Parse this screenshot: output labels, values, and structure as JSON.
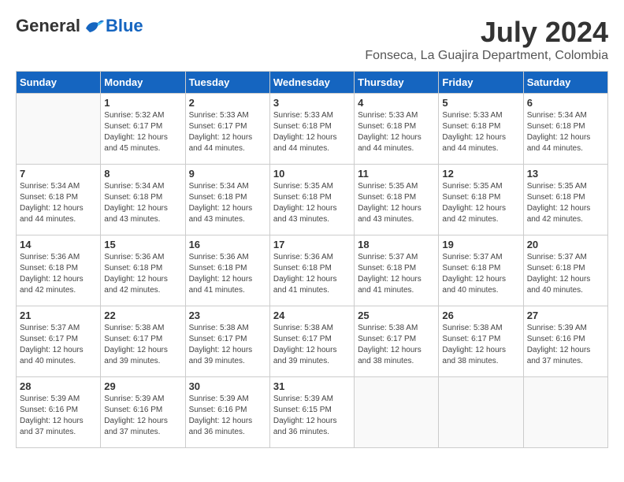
{
  "logo": {
    "general": "General",
    "blue": "Blue"
  },
  "title": {
    "month_year": "July 2024",
    "location": "Fonseca, La Guajira Department, Colombia"
  },
  "weekdays": [
    "Sunday",
    "Monday",
    "Tuesday",
    "Wednesday",
    "Thursday",
    "Friday",
    "Saturday"
  ],
  "weeks": [
    [
      {
        "day": "",
        "info": ""
      },
      {
        "day": "1",
        "info": "Sunrise: 5:32 AM\nSunset: 6:17 PM\nDaylight: 12 hours\nand 45 minutes."
      },
      {
        "day": "2",
        "info": "Sunrise: 5:33 AM\nSunset: 6:17 PM\nDaylight: 12 hours\nand 44 minutes."
      },
      {
        "day": "3",
        "info": "Sunrise: 5:33 AM\nSunset: 6:18 PM\nDaylight: 12 hours\nand 44 minutes."
      },
      {
        "day": "4",
        "info": "Sunrise: 5:33 AM\nSunset: 6:18 PM\nDaylight: 12 hours\nand 44 minutes."
      },
      {
        "day": "5",
        "info": "Sunrise: 5:33 AM\nSunset: 6:18 PM\nDaylight: 12 hours\nand 44 minutes."
      },
      {
        "day": "6",
        "info": "Sunrise: 5:34 AM\nSunset: 6:18 PM\nDaylight: 12 hours\nand 44 minutes."
      }
    ],
    [
      {
        "day": "7",
        "info": "Sunrise: 5:34 AM\nSunset: 6:18 PM\nDaylight: 12 hours\nand 44 minutes."
      },
      {
        "day": "8",
        "info": "Sunrise: 5:34 AM\nSunset: 6:18 PM\nDaylight: 12 hours\nand 43 minutes."
      },
      {
        "day": "9",
        "info": "Sunrise: 5:34 AM\nSunset: 6:18 PM\nDaylight: 12 hours\nand 43 minutes."
      },
      {
        "day": "10",
        "info": "Sunrise: 5:35 AM\nSunset: 6:18 PM\nDaylight: 12 hours\nand 43 minutes."
      },
      {
        "day": "11",
        "info": "Sunrise: 5:35 AM\nSunset: 6:18 PM\nDaylight: 12 hours\nand 43 minutes."
      },
      {
        "day": "12",
        "info": "Sunrise: 5:35 AM\nSunset: 6:18 PM\nDaylight: 12 hours\nand 42 minutes."
      },
      {
        "day": "13",
        "info": "Sunrise: 5:35 AM\nSunset: 6:18 PM\nDaylight: 12 hours\nand 42 minutes."
      }
    ],
    [
      {
        "day": "14",
        "info": "Sunrise: 5:36 AM\nSunset: 6:18 PM\nDaylight: 12 hours\nand 42 minutes."
      },
      {
        "day": "15",
        "info": "Sunrise: 5:36 AM\nSunset: 6:18 PM\nDaylight: 12 hours\nand 42 minutes."
      },
      {
        "day": "16",
        "info": "Sunrise: 5:36 AM\nSunset: 6:18 PM\nDaylight: 12 hours\nand 41 minutes."
      },
      {
        "day": "17",
        "info": "Sunrise: 5:36 AM\nSunset: 6:18 PM\nDaylight: 12 hours\nand 41 minutes."
      },
      {
        "day": "18",
        "info": "Sunrise: 5:37 AM\nSunset: 6:18 PM\nDaylight: 12 hours\nand 41 minutes."
      },
      {
        "day": "19",
        "info": "Sunrise: 5:37 AM\nSunset: 6:18 PM\nDaylight: 12 hours\nand 40 minutes."
      },
      {
        "day": "20",
        "info": "Sunrise: 5:37 AM\nSunset: 6:18 PM\nDaylight: 12 hours\nand 40 minutes."
      }
    ],
    [
      {
        "day": "21",
        "info": "Sunrise: 5:37 AM\nSunset: 6:17 PM\nDaylight: 12 hours\nand 40 minutes."
      },
      {
        "day": "22",
        "info": "Sunrise: 5:38 AM\nSunset: 6:17 PM\nDaylight: 12 hours\nand 39 minutes."
      },
      {
        "day": "23",
        "info": "Sunrise: 5:38 AM\nSunset: 6:17 PM\nDaylight: 12 hours\nand 39 minutes."
      },
      {
        "day": "24",
        "info": "Sunrise: 5:38 AM\nSunset: 6:17 PM\nDaylight: 12 hours\nand 39 minutes."
      },
      {
        "day": "25",
        "info": "Sunrise: 5:38 AM\nSunset: 6:17 PM\nDaylight: 12 hours\nand 38 minutes."
      },
      {
        "day": "26",
        "info": "Sunrise: 5:38 AM\nSunset: 6:17 PM\nDaylight: 12 hours\nand 38 minutes."
      },
      {
        "day": "27",
        "info": "Sunrise: 5:39 AM\nSunset: 6:16 PM\nDaylight: 12 hours\nand 37 minutes."
      }
    ],
    [
      {
        "day": "28",
        "info": "Sunrise: 5:39 AM\nSunset: 6:16 PM\nDaylight: 12 hours\nand 37 minutes."
      },
      {
        "day": "29",
        "info": "Sunrise: 5:39 AM\nSunset: 6:16 PM\nDaylight: 12 hours\nand 37 minutes."
      },
      {
        "day": "30",
        "info": "Sunrise: 5:39 AM\nSunset: 6:16 PM\nDaylight: 12 hours\nand 36 minutes."
      },
      {
        "day": "31",
        "info": "Sunrise: 5:39 AM\nSunset: 6:15 PM\nDaylight: 12 hours\nand 36 minutes."
      },
      {
        "day": "",
        "info": ""
      },
      {
        "day": "",
        "info": ""
      },
      {
        "day": "",
        "info": ""
      }
    ]
  ]
}
